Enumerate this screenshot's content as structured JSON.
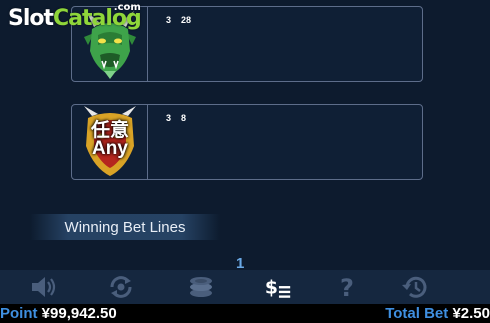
{
  "watermark": {
    "part1": "Slot",
    "part2": "Catalog",
    "part3": ".com"
  },
  "paytable": [
    {
      "symbol": "dragon-head-icon",
      "count": "3",
      "payout": "28"
    },
    {
      "symbol": "any-symbol-icon",
      "label": "任意\nAny",
      "label_line1": "任意",
      "label_line2": "Any",
      "count": "3",
      "payout": "8"
    }
  ],
  "winning_bet_lines_label": "Winning Bet Lines",
  "page_indicator": "1",
  "toolbar": {
    "icons": [
      "speaker-icon",
      "autoplay-icon",
      "coins-icon",
      "paytable-icon",
      "help-icon",
      "history-icon"
    ],
    "active": "paytable-icon"
  },
  "status": {
    "point_label": "Point",
    "point_value": "¥99,942.50",
    "total_bet_label": "Total Bet",
    "total_bet_value": "¥2.50"
  },
  "colors": {
    "background": "#0d1b2e",
    "card_border": "#5d6d8a",
    "label_blue": "#3f8fe0",
    "page_blue": "#6aa9e6"
  }
}
